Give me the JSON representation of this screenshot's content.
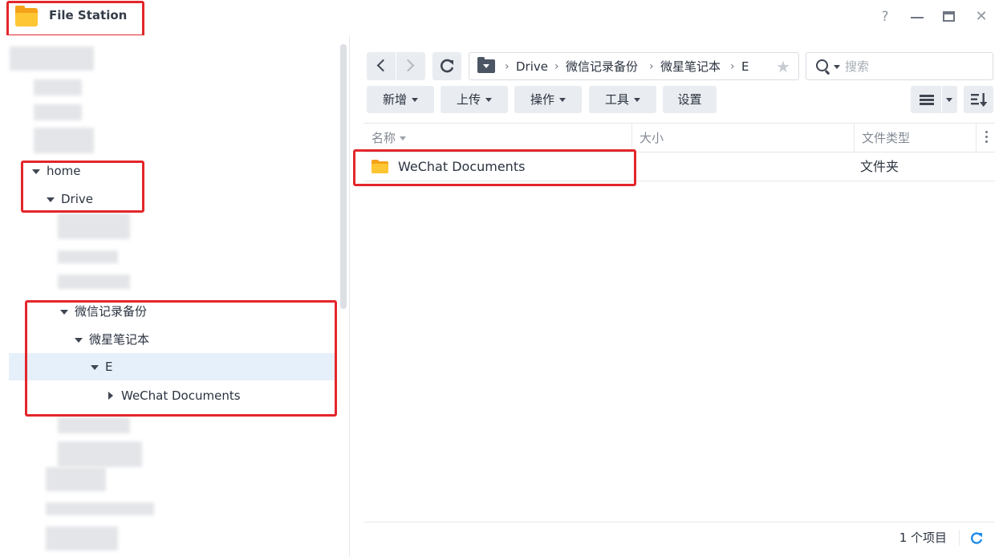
{
  "app": {
    "title": "File Station",
    "help_label": "?",
    "close_label": "✕"
  },
  "tree": {
    "home": "home",
    "drive": "Drive",
    "wechat_backup": "微信记录备份",
    "wx_notebook": "微星笔记本",
    "e": "E",
    "wechat_docs": "WeChat Documents"
  },
  "breadcrumb": [
    "Drive",
    "微信记录备份",
    "微星笔记本",
    "E"
  ],
  "search": {
    "placeholder": "搜索"
  },
  "toolbar": {
    "create": "新增",
    "upload": "上传",
    "action": "操作",
    "tools": "工具",
    "settings": "设置"
  },
  "columns": {
    "name": "名称",
    "size": "大小",
    "type": "文件类型"
  },
  "files": [
    {
      "name": "WeChat Documents",
      "size": "",
      "type": "文件夹"
    }
  ],
  "status": {
    "count": "1 个项目"
  },
  "colors": {
    "accent": "#1f8ceb",
    "selection": "#e6f0fb",
    "annotation": "#e3262a",
    "folder": "#ffc634"
  }
}
